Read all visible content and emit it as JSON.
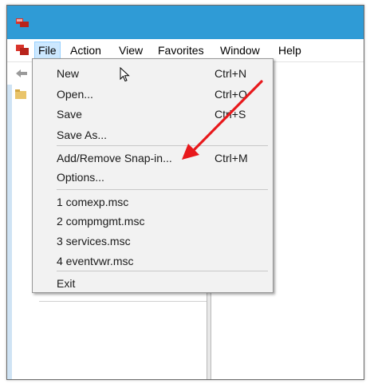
{
  "menubar": {
    "items": [
      {
        "label": "File"
      },
      {
        "label": "Action"
      },
      {
        "label": "View"
      },
      {
        "label": "Favorites"
      },
      {
        "label": "Window"
      },
      {
        "label": "Help"
      }
    ]
  },
  "file_menu": {
    "items": [
      {
        "label": "New",
        "shortcut": "Ctrl+N"
      },
      {
        "label": "Open...",
        "shortcut": "Ctrl+O"
      },
      {
        "label": "Save",
        "shortcut": "Ctrl+S"
      },
      {
        "label": "Save As...",
        "shortcut": ""
      },
      {
        "label": "Add/Remove Snap-in...",
        "shortcut": "Ctrl+M"
      },
      {
        "label": "Options...",
        "shortcut": ""
      },
      {
        "label": "1 comexp.msc",
        "shortcut": ""
      },
      {
        "label": "2 compmgmt.msc",
        "shortcut": ""
      },
      {
        "label": "3 services.msc",
        "shortcut": ""
      },
      {
        "label": "4 eventvwr.msc",
        "shortcut": ""
      },
      {
        "label": "Exit",
        "shortcut": ""
      }
    ]
  },
  "icons": {
    "app": "mmc-app-icon",
    "document": "console-document-icon",
    "back": "back-arrow-icon",
    "tree": "folder-icon",
    "cursor": "mouse-pointer-icon",
    "annotation": "red-arrow-annotation"
  },
  "colors": {
    "titlebar": "#2f9bd6",
    "menu_highlight": "#cce8ff",
    "dropdown_bg": "#f2f2f2",
    "annotation_arrow": "#e8191c"
  }
}
